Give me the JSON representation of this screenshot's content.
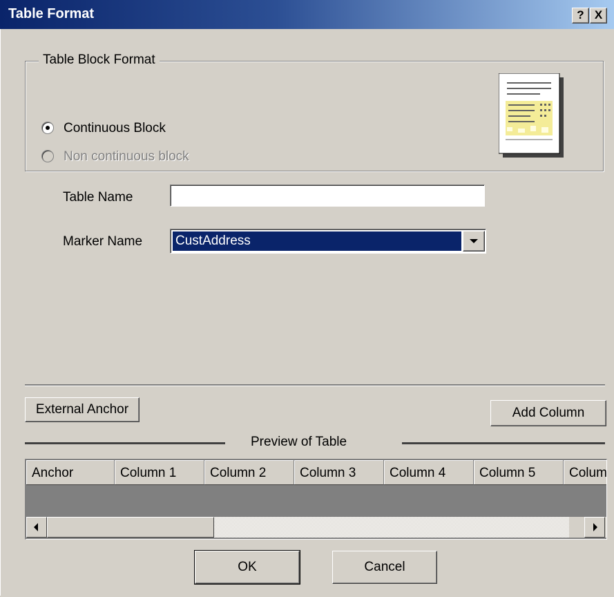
{
  "window": {
    "title": "Table Format",
    "help_label": "?",
    "close_label": "X"
  },
  "block_format": {
    "legend": "Table Block Format",
    "options": [
      {
        "label": "Continuous Block",
        "selected": true,
        "enabled": true
      },
      {
        "label": "Non continuous block",
        "selected": false,
        "enabled": false
      }
    ]
  },
  "form": {
    "table_name_label": "Table Name",
    "table_name_value": "",
    "marker_name_label": "Marker Name",
    "marker_name_value": "CustAddress"
  },
  "buttons": {
    "external_anchor": "External Anchor",
    "add_column": "Add Column",
    "ok": "OK",
    "cancel": "Cancel"
  },
  "preview": {
    "caption": "Preview of Table",
    "columns": [
      "Anchor",
      "Column 1",
      "Column 2",
      "Column 3",
      "Column 4",
      "Column 5",
      "Colum"
    ]
  },
  "colors": {
    "titlebar": "#0a246a",
    "face": "#d4d0c8",
    "selection": "#0a246a"
  }
}
